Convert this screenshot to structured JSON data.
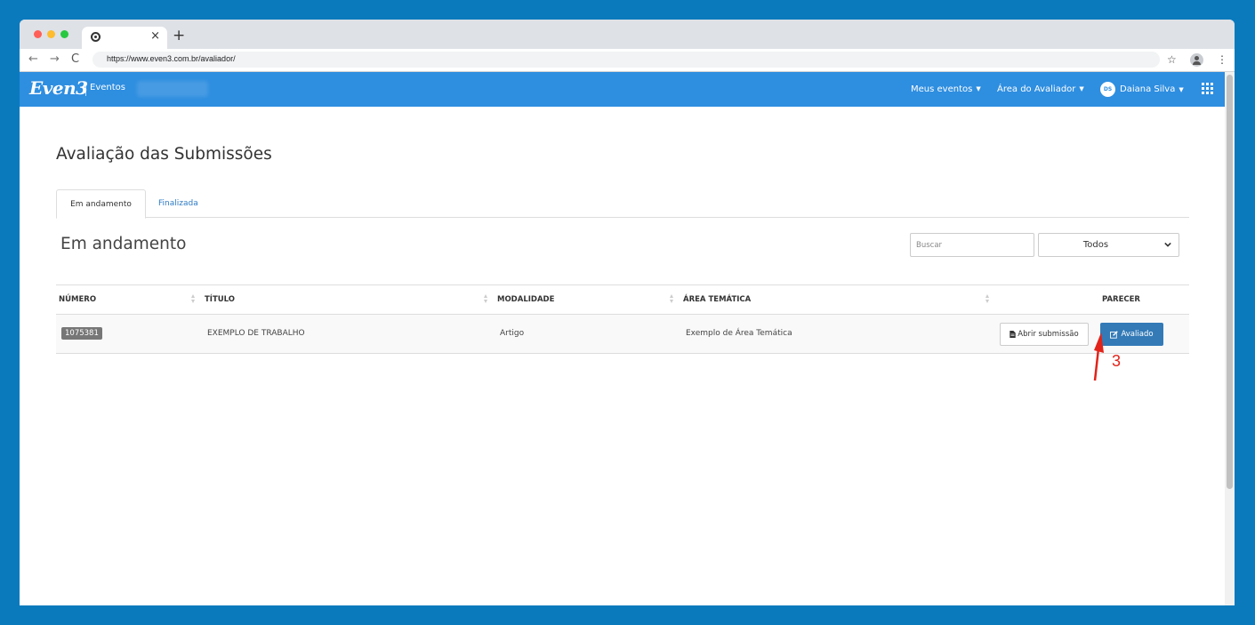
{
  "browser": {
    "tab": {
      "title": "",
      "close_glyph": "×",
      "new_glyph": "+"
    },
    "toolbar": {
      "back_glyph": "←",
      "forward_glyph": "→",
      "reload_glyph": "C",
      "url": "https://www.even3.com.br/avaliador/",
      "star_glyph": "☆",
      "menu_glyph": "⋮"
    }
  },
  "appbar": {
    "logo": "Even3",
    "logo_sub": "Eventos",
    "nav": {
      "meus_eventos": "Meus eventos",
      "area_avaliador": "Área do Avaliador",
      "user_initials": "DS",
      "user_name": "Daiana Silva",
      "caret": "▼"
    },
    "colors": {
      "bar": "#2e8ee0"
    }
  },
  "page": {
    "title": "Avaliação das Submissões",
    "tabs": [
      {
        "label": "Em andamento",
        "active": true
      },
      {
        "label": "Finalizada",
        "active": false
      }
    ],
    "section_title": "Em andamento",
    "search": {
      "placeholder": "Buscar",
      "value": ""
    },
    "filter": {
      "selected": "Todos"
    }
  },
  "table": {
    "headers": {
      "numero": "NÚMERO",
      "titulo": "TÍTULO",
      "modalidade": "MODALIDADE",
      "area_tematica": "ÁREA TEMÁTICA",
      "actions": "",
      "parecer": "PARECER"
    },
    "rows": [
      {
        "numero": "1075381",
        "titulo": "EXEMPLO DE TRABALHO",
        "modalidade": "Artigo",
        "area_tematica": "Exemplo de Área Temática",
        "open_label": "Abrir submissão",
        "status_label": "Avaliado"
      }
    ]
  },
  "annotation": {
    "label": "3",
    "color": "#e2231a"
  },
  "icons": {
    "tab_favicon": "chrome-icon",
    "doc": "file-icon",
    "edit": "edit-icon",
    "apps": "apps-grid-icon",
    "profile": "profile-icon"
  }
}
